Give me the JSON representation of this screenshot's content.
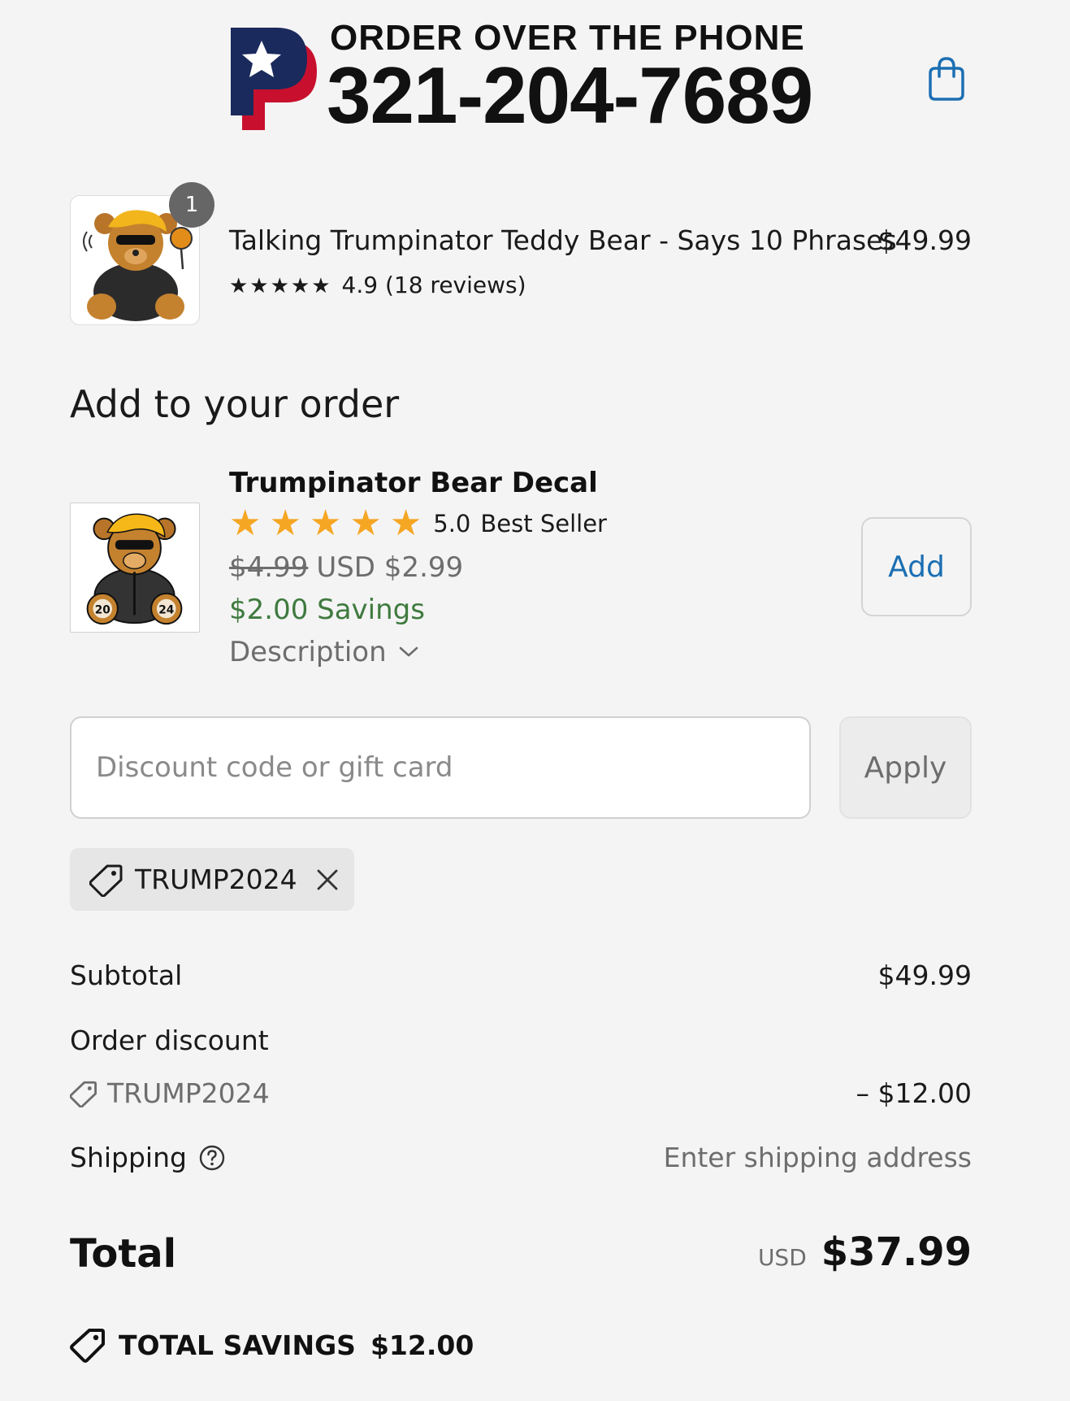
{
  "header": {
    "phone_heading": "ORDER OVER THE PHONE",
    "phone_number": "321-204-7689",
    "logo_letter": "P"
  },
  "cart_item": {
    "quantity": "1",
    "title": "Talking Trumpinator Teddy Bear - Says 10 Phrases",
    "price": "$49.99",
    "stars": "★★★★★",
    "rating_text": "4.9 (18 reviews)"
  },
  "upsell": {
    "section_title": "Add to your order",
    "title": "Trumpinator Bear Decal",
    "rating_score": "5.0",
    "badge": "Best Seller",
    "original_price": "$4.99",
    "price": "USD $2.99",
    "savings": "$2.00 Savings",
    "description_label": "Description",
    "add_label": "Add",
    "bear_numbers": [
      "20",
      "24"
    ]
  },
  "discount": {
    "placeholder": "Discount code or gift card",
    "apply_label": "Apply",
    "applied_code": "TRUMP2024"
  },
  "summary": {
    "subtotal_label": "Subtotal",
    "subtotal_value": "$49.99",
    "order_discount_label": "Order discount",
    "discount_code": "TRUMP2024",
    "discount_value": "– $12.00",
    "shipping_label": "Shipping",
    "shipping_value": "Enter shipping address",
    "total_label": "Total",
    "total_currency": "USD",
    "total_value": "$37.99",
    "savings_label": "TOTAL SAVINGS",
    "savings_value": "$12.00"
  },
  "colors": {
    "accent_blue": "#1c6fb3",
    "savings_green": "#3f7a3f",
    "star_orange": "#f5a623",
    "logo_navy": "#1b2a5c",
    "logo_red": "#c8102e"
  }
}
